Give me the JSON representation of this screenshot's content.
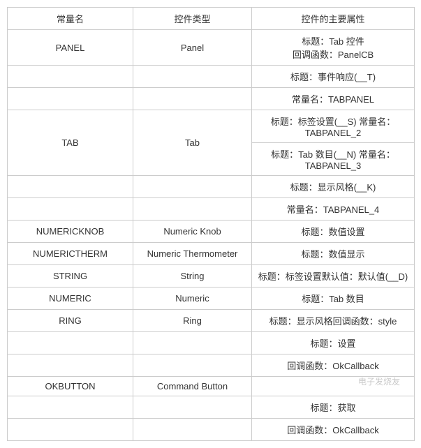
{
  "headers": [
    "常量名",
    "控件类型",
    "控件的主要属性"
  ],
  "rows": [
    {
      "col1": "PANEL",
      "col1_rowspan": 1,
      "col2": "Panel",
      "col2_rowspan": 1,
      "col3": "标题：Tab 控件\n回调函数：PanelCB"
    },
    {
      "col1": "",
      "col2": "",
      "col3": "标题：事件响应(__T)"
    },
    {
      "col1": "",
      "col2": "",
      "col3": "常量名：TABPANEL"
    },
    {
      "col1": "TAB",
      "col1_rowspan": 2,
      "col2": "Tab",
      "col2_rowspan": 2,
      "col3": "标题：标签设置(__S) 常量名：TABPANEL_2"
    },
    {
      "col3": "标题：Tab 数目(__N) 常量名：TABPANEL_3"
    },
    {
      "col1": "",
      "col2": "",
      "col3": "标题：显示风格(__K)"
    },
    {
      "col1": "",
      "col2": "",
      "col3": "常量名：TABPANEL_4"
    },
    {
      "col1": "NUMERICKNOB",
      "col2": "Numeric Knob",
      "col3": "标题：数值设置"
    },
    {
      "col1": "NUMERICTHERM",
      "col2": "Numeric Thermometer",
      "col3": "标题：数值显示"
    },
    {
      "col1": "STRING",
      "col2": "String",
      "col3": "标题：标签设置默认值：默认值(__D)"
    },
    {
      "col1": "NUMERIC",
      "col2": "Numeric",
      "col3": "标题：Tab 数目"
    },
    {
      "col1": "RING",
      "col2": "Ring",
      "col3": "标题：显示风格回调函数：style"
    },
    {
      "col1": "",
      "col2": "",
      "col3": "标题：设置"
    },
    {
      "col1": "",
      "col2": "",
      "col3": "回调函数：OkCallback"
    },
    {
      "col1": "OKBUTTON",
      "col1_rowspan": 1,
      "col2": "Command Button",
      "col2_rowspan": 1,
      "col3": ""
    },
    {
      "col1": "",
      "col2": "",
      "col3": "标题：获取"
    },
    {
      "col1": "",
      "col2": "",
      "col3": "回调函数：OkCallback"
    }
  ],
  "watermark": "电子发烧友"
}
